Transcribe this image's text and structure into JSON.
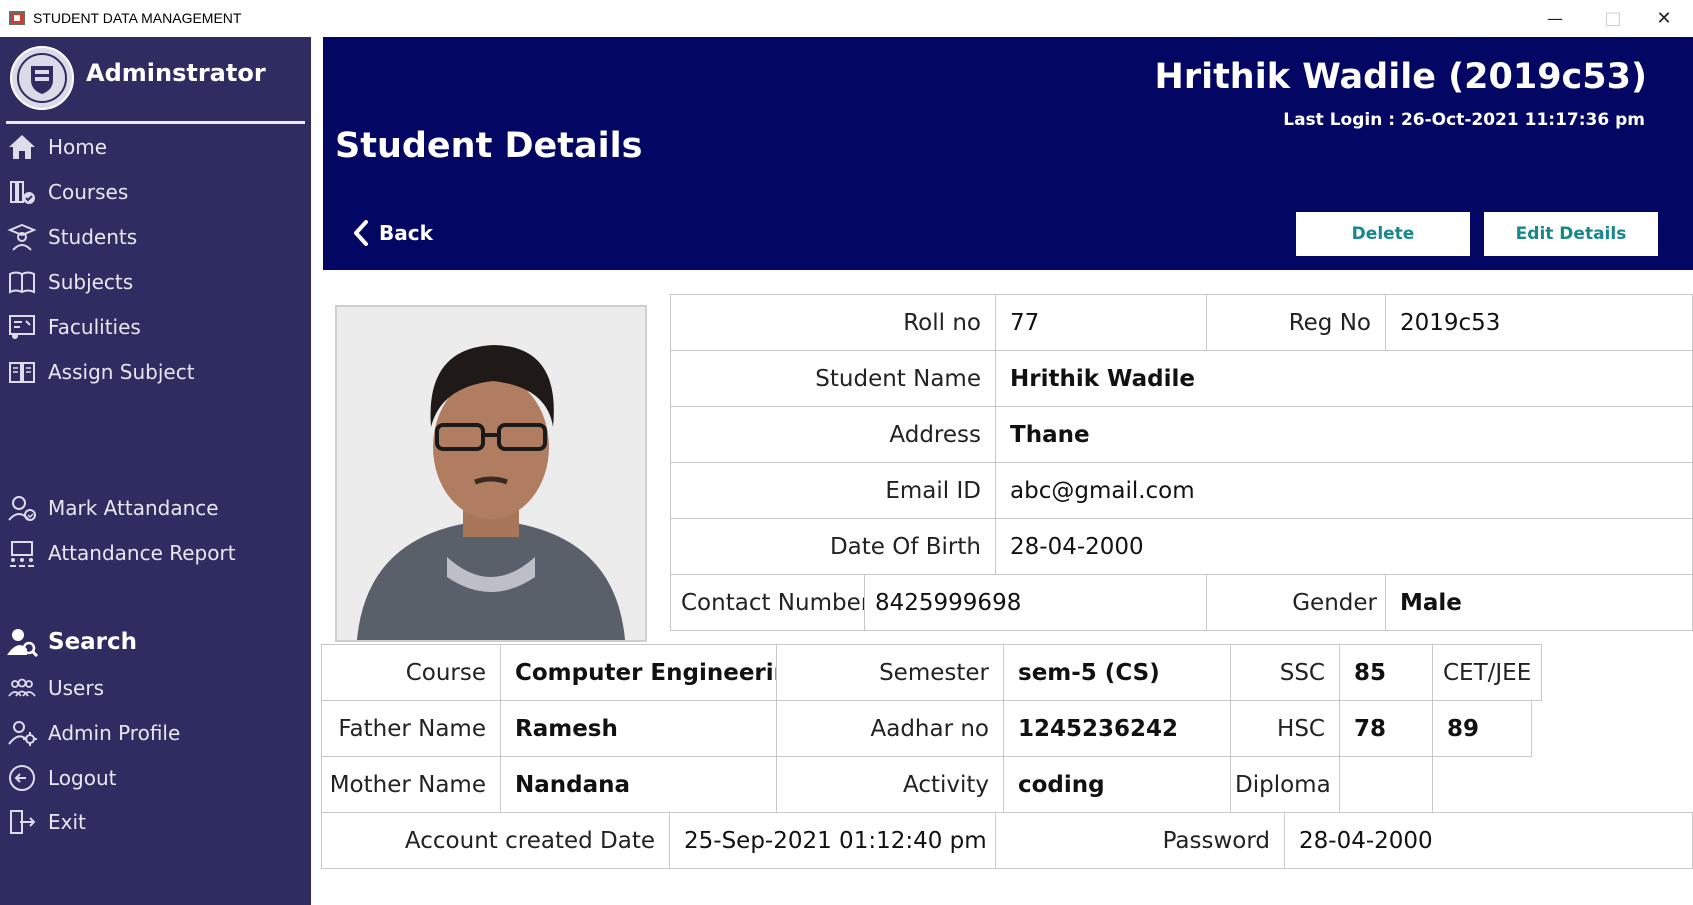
{
  "window": {
    "title": "STUDENT DATA MANAGEMENT",
    "minimize": "—",
    "maximize": "□",
    "close": "✕"
  },
  "sidebar": {
    "admin_name": "Adminstrator",
    "items": [
      {
        "label": "Home",
        "icon": "home-icon"
      },
      {
        "label": "Courses",
        "icon": "courses-icon"
      },
      {
        "label": "Students",
        "icon": "students-icon"
      },
      {
        "label": "Subjects",
        "icon": "subjects-icon"
      },
      {
        "label": "Faculities",
        "icon": "faculties-icon"
      },
      {
        "label": "Assign Subject",
        "icon": "assign-subject-icon"
      },
      {
        "label": "Mark Attandance",
        "icon": "mark-attendance-icon"
      },
      {
        "label": "Attandance Report",
        "icon": "attendance-report-icon"
      },
      {
        "label": "Search",
        "icon": "search-user-icon"
      },
      {
        "label": "Users",
        "icon": "users-icon"
      },
      {
        "label": "Admin Profile",
        "icon": "admin-profile-icon"
      },
      {
        "label": "Logout",
        "icon": "logout-icon"
      },
      {
        "label": "Exit",
        "icon": "exit-icon"
      }
    ]
  },
  "header": {
    "page_title": "Student Details",
    "user": "Hrithik Wadile (2019c53)",
    "last_login": "Last Login : 26-Oct-2021 11:17:36 pm",
    "back_label": "Back",
    "delete_label": "Delete",
    "edit_label": "Edit Details"
  },
  "details": {
    "roll_label": "Roll no",
    "roll": "77",
    "reg_label": "Reg No",
    "reg": "2019c53",
    "name_label": "Student Name",
    "name": "Hrithik Wadile",
    "address_label": "Address",
    "address": "Thane",
    "email_label": "Email ID",
    "email": "abc@gmail.com",
    "dob_label": "Date Of Birth",
    "dob": "28-04-2000",
    "contact_label": "Contact Number",
    "contact": "8425999698",
    "gender_label": "Gender",
    "gender": "Male"
  },
  "academic": {
    "course_label": "Course",
    "course": "Computer Engineering",
    "semester_label": "Semester",
    "semester": "sem-5  (CS)",
    "ssc_label": "SSC",
    "ssc": "85",
    "cet_label": "CET/JEE",
    "cet": "89",
    "father_label": "Father Name",
    "father": "Ramesh",
    "aadhar_label": "Aadhar no",
    "aadhar": "1245236242",
    "hsc_label": "HSC",
    "hsc": "78",
    "mother_label": "Mother Name",
    "mother": "Nandana",
    "activity_label": "Activity",
    "activity": "coding",
    "diploma_label": "Diploma",
    "diploma": "",
    "created_label": "Account created Date",
    "created": "25-Sep-2021 01:12:40 pm",
    "password_label": "Password",
    "password": "28-04-2000"
  }
}
